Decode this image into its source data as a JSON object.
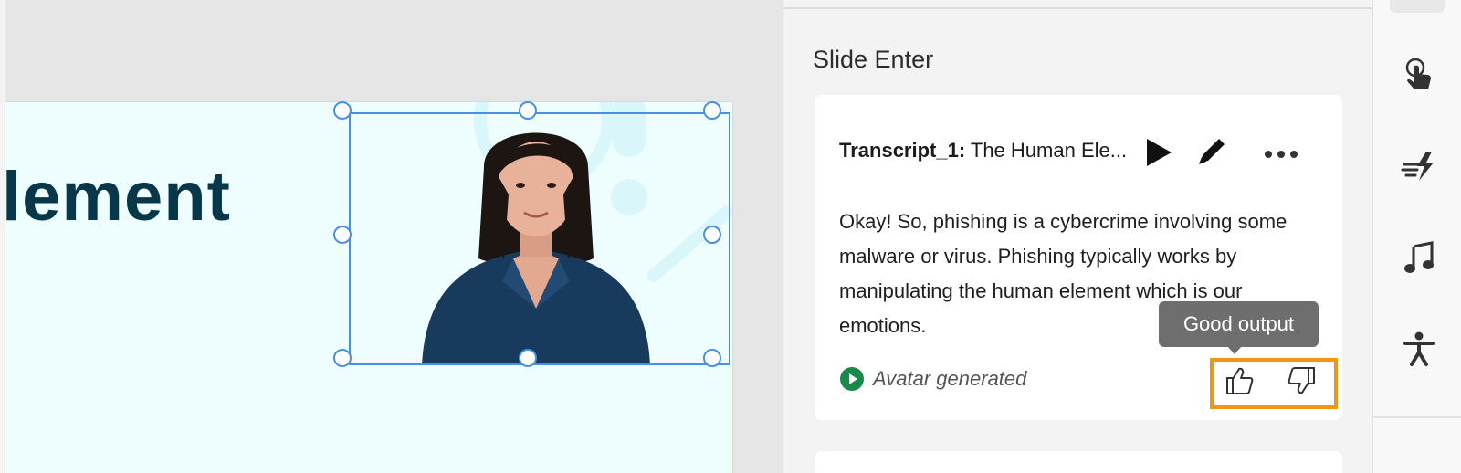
{
  "slide": {
    "title_fragment": "lement"
  },
  "panel": {
    "section_title": "Slide Enter",
    "transcript": {
      "name_label": "Transcript_1:",
      "name_value": " The Human Ele...",
      "body": "Okay! So, phishing is a cybercrime involving some malware or virus. Phishing typically works by manipulating the human element which is our emotions.",
      "status": "Avatar generated",
      "status_color": "#1a8a4a"
    },
    "tooltip": "Good output",
    "highlight_color": "#f39416"
  },
  "rail": {
    "icons": [
      "touch-icon",
      "transition-icon",
      "music-note-icon",
      "accessibility-icon"
    ]
  },
  "colors": {
    "selection": "#4a90e2",
    "slide_bg": "#eefdfe",
    "title": "#08374a"
  }
}
